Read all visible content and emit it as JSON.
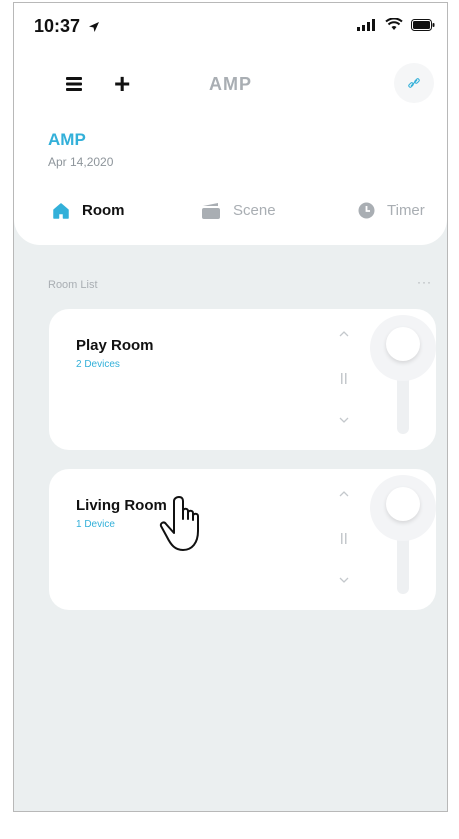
{
  "status_bar": {
    "time": "10:37"
  },
  "nav": {
    "title": "AMP"
  },
  "home": {
    "name": "AMP",
    "date": "Apr 14,2020"
  },
  "tabs": [
    {
      "label": "Room",
      "icon": "house-icon",
      "active": true
    },
    {
      "label": "Scene",
      "icon": "scene-icon",
      "active": false
    },
    {
      "label": "Timer",
      "icon": "clock-icon",
      "active": false
    }
  ],
  "room_list": {
    "header": "Room List",
    "more": "···",
    "rooms": [
      {
        "name": "Play Room",
        "devices": "2 Devices",
        "slider_level": 1.0
      },
      {
        "name": "Living Room",
        "devices": "1 Device",
        "slider_level": 1.0
      }
    ]
  },
  "colors": {
    "accent": "#33b0d9",
    "background": "#ebeff0",
    "card": "#ffffff"
  }
}
